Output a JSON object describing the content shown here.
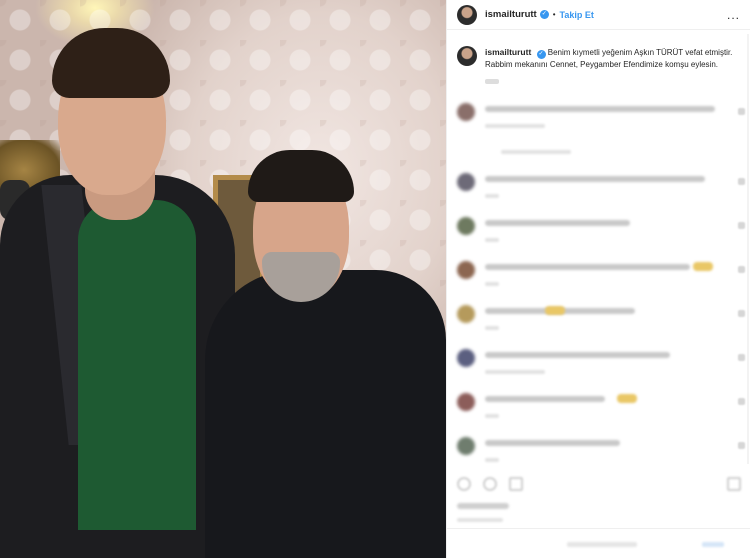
{
  "header": {
    "username": "ismailturutt",
    "separator": "•",
    "follow_label": "Takip Et",
    "more_label": "..."
  },
  "caption": {
    "username": "ismailturutt",
    "text": "Benim kıymetli yeğenim Aşkın TÜRÜT vefat etmiştir. Rabbim mekanını Cennet, Peygamber Efendimize komşu eylesin."
  },
  "verified_icon": "✓",
  "colors": {
    "follow": "#3897f0",
    "verified": "#3897f0",
    "text": "#262626"
  },
  "comments_blurred": true
}
